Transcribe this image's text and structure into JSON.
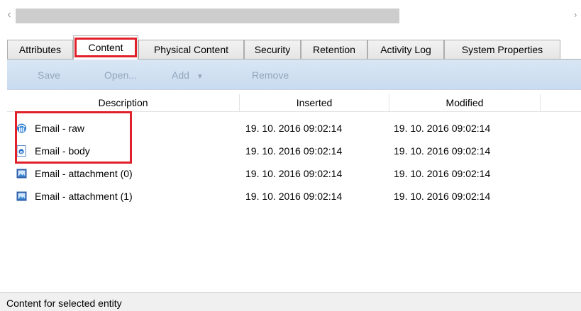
{
  "tabs": [
    {
      "label": "Attributes"
    },
    {
      "label": "Content",
      "active": true
    },
    {
      "label": "Physical Content"
    },
    {
      "label": "Security"
    },
    {
      "label": "Retention"
    },
    {
      "label": "Activity Log"
    },
    {
      "label": "System Properties"
    }
  ],
  "toolbar": {
    "save_label": "Save",
    "open_label": "Open...",
    "add_label": "Add",
    "add_arrow": "▼",
    "remove_label": "Remove",
    "enabled": false
  },
  "grid": {
    "columns": [
      "Description",
      "Inserted",
      "Modified"
    ],
    "rows": [
      {
        "icon": "email-raw-icon",
        "description": "Email - raw",
        "inserted": "19. 10. 2016 09:02:14",
        "modified": "19. 10. 2016 09:02:14"
      },
      {
        "icon": "html-document-icon",
        "description": "Email - body",
        "inserted": "19. 10. 2016 09:02:14",
        "modified": "19. 10. 2016 09:02:14"
      },
      {
        "icon": "image-attachment-icon",
        "description": "Email - attachment (0)",
        "inserted": "19. 10. 2016 09:02:14",
        "modified": "19. 10. 2016 09:02:14"
      },
      {
        "icon": "image-attachment-icon",
        "description": "Email - attachment (1)",
        "inserted": "19. 10. 2016 09:02:14",
        "modified": "19. 10. 2016 09:02:14"
      }
    ]
  },
  "status": {
    "text": "Content for selected entity"
  },
  "colors": {
    "highlight": "#e0202a",
    "toolbar": "#d2e1f2",
    "disabled_text": "#93a6bc"
  }
}
